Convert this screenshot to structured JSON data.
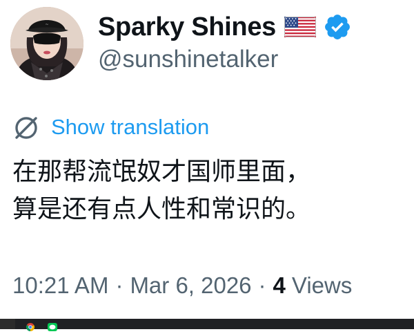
{
  "author": {
    "display_name": "Sparky Shines",
    "handle": "@sunshinetalker",
    "flag_icon": "us-flag-icon",
    "verified_icon": "verified-badge-icon",
    "verified_color": "#1d9bf0"
  },
  "translation": {
    "icon": "globe-icon",
    "label": "Show translation",
    "color": "#1d9bf0"
  },
  "tweet": {
    "lines": [
      "在那帮流氓奴才国师里面，",
      "算是还有点人性和常识的。"
    ]
  },
  "meta": {
    "time": "10:21 AM",
    "separator": "·",
    "date": "Mar 6, 2026",
    "views_count": "4",
    "views_label": "Views"
  },
  "taskbar": {
    "icons": [
      "chrome-icon",
      "line-app-icon"
    ]
  },
  "colors": {
    "text_primary": "#0f1419",
    "text_secondary": "#536471",
    "link": "#1d9bf0"
  }
}
